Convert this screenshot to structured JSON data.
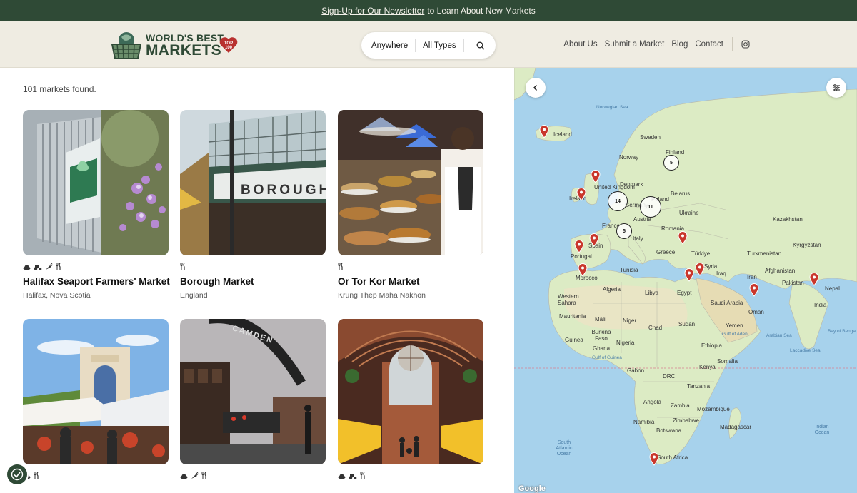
{
  "banner": {
    "link_text": "Sign-Up for Our Newsletter",
    "rest_text": "to Learn About New Markets"
  },
  "logo": {
    "line1": "WORLD'S BEST",
    "line2": "MARKETS",
    "badge_top": "TOP",
    "badge_num": "100"
  },
  "search": {
    "where": "Anywhere",
    "type": "All Types"
  },
  "nav": {
    "items": [
      "About Us",
      "Submit a Market",
      "Blog",
      "Contact"
    ]
  },
  "listing": {
    "count": "101 markets found.",
    "cards": [
      {
        "title": "Halifax Seaport Farmers' Market",
        "location": "Halifax, Nova Scotia",
        "icons": [
          "hat-icon",
          "tractor-icon",
          "carrot-icon",
          "utensils-icon"
        ]
      },
      {
        "title": "Borough Market",
        "location": "England",
        "icons": [
          "utensils-icon"
        ]
      },
      {
        "title": "Or Tor Kor Market",
        "location": "Krung Thep Maha Nakhon",
        "icons": [
          "utensils-icon"
        ]
      },
      {
        "title": "",
        "location": "",
        "icons": [
          "hat-icon",
          "utensils-icon"
        ]
      },
      {
        "title": "",
        "location": "",
        "icons": [
          "hat-icon",
          "carrot-icon",
          "utensils-icon"
        ]
      },
      {
        "title": "",
        "location": "",
        "icons": [
          "hat-icon",
          "tractor-icon",
          "utensils-icon"
        ]
      }
    ]
  },
  "map": {
    "clusters": [
      "5",
      "14",
      "11",
      "5"
    ],
    "labels": {
      "norwegian_sea": "Norwegian Sea",
      "iceland": "Iceland",
      "sweden": "Sweden",
      "finland": "Finland",
      "norway": "Norway",
      "uk": "United Kingdom",
      "ireland": "Ireland",
      "denmark": "Denmark",
      "belarus": "Belarus",
      "germany": "Germany",
      "poland": "Poland",
      "ukraine": "Ukraine",
      "austria": "Austria",
      "france": "France",
      "kazakhstan": "Kazakhstan",
      "romania": "Romania",
      "italy": "Italy",
      "spain": "Spain",
      "portugal": "Portugal",
      "kyrgyzstan": "Kyrgyzstan",
      "greece": "Greece",
      "turkiye": "Türkiye",
      "turkmenistan": "Turkmenistan",
      "tunisia": "Tunisia",
      "morocco": "Morocco",
      "syria": "Syria",
      "iraq": "Iraq",
      "afghanistan": "Afghanistan",
      "iran": "Iran",
      "pakistan": "Pakistan",
      "nepal": "Nepal",
      "algeria": "Algeria",
      "libya": "Libya",
      "egypt": "Egypt",
      "western_sahara": "Western Sahara",
      "saudi": "Saudi Arabia",
      "india": "India",
      "oman": "Oman",
      "mauritania": "Mauritania",
      "mali": "Mali",
      "niger": "Niger",
      "chad": "Chad",
      "sudan": "Sudan",
      "yemen": "Yemen",
      "gulf_aden": "Gulf of Aden",
      "arabian_sea": "Arabian Sea",
      "bay_bengal": "Bay of Bengal",
      "burkina": "Burkina Faso",
      "guinea": "Guinea",
      "nigeria": "Nigeria",
      "ethiopia": "Ethiopia",
      "ghana": "Ghana",
      "gulf_guinea": "Gulf of Guinea",
      "somalia": "Somalia",
      "laccadive": "Laccadive Sea",
      "gabon": "Gabon",
      "kenya": "Kenya",
      "drc": "DRC",
      "tanzania": "Tanzania",
      "angola": "Angola",
      "zambia": "Zambia",
      "mozambique": "Mozambique",
      "zimbabwe": "Zimbabwe",
      "namibia": "Namibia",
      "madagascar": "Madagascar",
      "botswana": "Botswana",
      "south_atlantic": "South Atlantic Ocean",
      "indian_ocean": "Indian Ocean",
      "south_africa": "South Africa",
      "google": "Google"
    }
  },
  "colors": {
    "brand_green": "#2f4a36",
    "header_bg": "#efece2",
    "pin_red": "#c9372c",
    "water": "#a7d2ec",
    "land": "#dcebc4"
  }
}
